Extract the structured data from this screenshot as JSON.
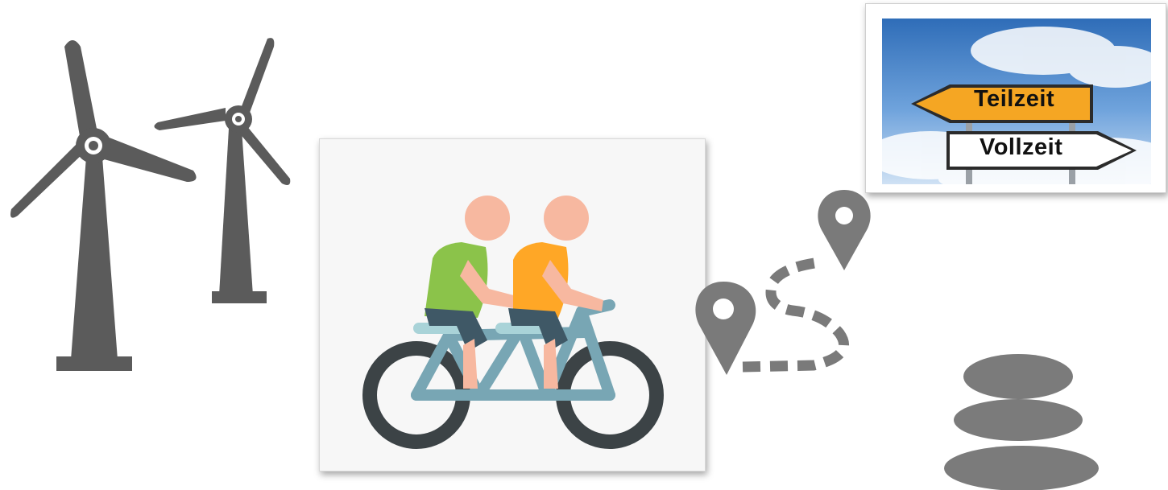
{
  "signs": {
    "left_sign": "Teilzeit",
    "right_sign": "Vollzeit"
  },
  "icons": {
    "wind_turbines": "wind-turbine-icon",
    "tandem_bicycle": "tandem-bicycle-icon",
    "route": "route-map-pin-icon",
    "stones": "stacked-stones-icon"
  },
  "colors": {
    "icon_gray": "#5b5b5b",
    "sign_yellow": "#f5a623",
    "sign_white": "#ffffff",
    "sky": "#4a86c8",
    "rider_green": "#8bc34a",
    "rider_orange": "#ffa726",
    "skin": "#f7b8a0",
    "bike_frame": "#78a6b4",
    "wheel": "#3c4346"
  }
}
